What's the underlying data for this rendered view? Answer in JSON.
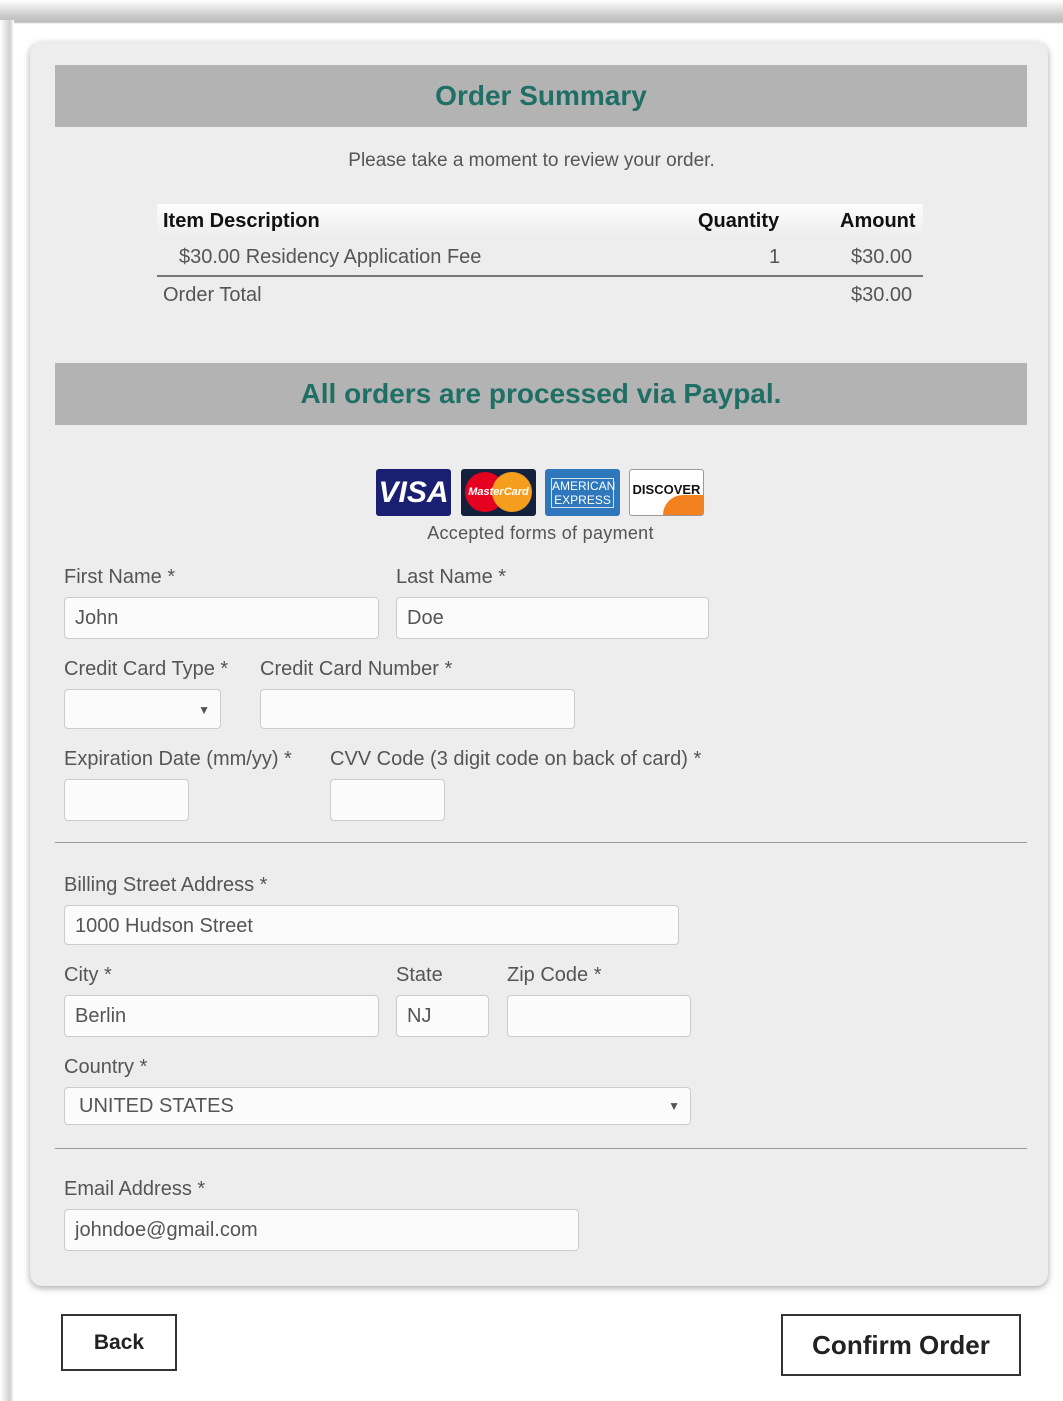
{
  "order_summary": {
    "title": "Order Summary",
    "intro": "Please take a moment to review your order.",
    "table": {
      "headers": {
        "description": "Item Description",
        "quantity": "Quantity",
        "amount": "Amount"
      },
      "rows": [
        {
          "description": "$30.00 Residency Application Fee",
          "quantity": "1",
          "amount": "$30.00"
        }
      ],
      "total_label": "Order Total",
      "total_value": "$30.00"
    }
  },
  "payment": {
    "banner": "All orders are processed via Paypal.",
    "accepted_label": "Accepted forms of payment",
    "card_logos": [
      {
        "icon": "visa-logo-icon",
        "text": "VISA"
      },
      {
        "icon": "mastercard-logo-icon",
        "text": "MasterCard"
      },
      {
        "icon": "amex-logo-icon",
        "text": "AMERICAN EXPRESS"
      },
      {
        "icon": "discover-logo-icon",
        "text": "DISCOVER"
      }
    ]
  },
  "form": {
    "first_name": {
      "label": "First Name *",
      "value": "John"
    },
    "last_name": {
      "label": "Last Name *",
      "value": "Doe"
    },
    "card_type": {
      "label": "Credit Card Type *",
      "value": ""
    },
    "card_number": {
      "label": "Credit Card Number *",
      "value": ""
    },
    "expiration": {
      "label": "Expiration Date (mm/yy) *",
      "value": ""
    },
    "cvv": {
      "label": "CVV Code (3 digit code on back of card) *",
      "value": ""
    },
    "street": {
      "label": "Billing Street Address *",
      "value": "1000 Hudson Street"
    },
    "city": {
      "label": "City *",
      "value": "Berlin"
    },
    "state": {
      "label": "State",
      "value": "NJ"
    },
    "zip": {
      "label": "Zip Code *",
      "value": ""
    },
    "country": {
      "label": "Country *",
      "value": "UNITED STATES"
    },
    "email": {
      "label": "Email Address *",
      "value": "johndoe@gmail.com"
    }
  },
  "buttons": {
    "back": "Back",
    "confirm": "Confirm Order"
  },
  "colors": {
    "banner_bg": "#b3b3b3",
    "banner_text": "#1f6f66",
    "card_bg": "#ededed"
  }
}
